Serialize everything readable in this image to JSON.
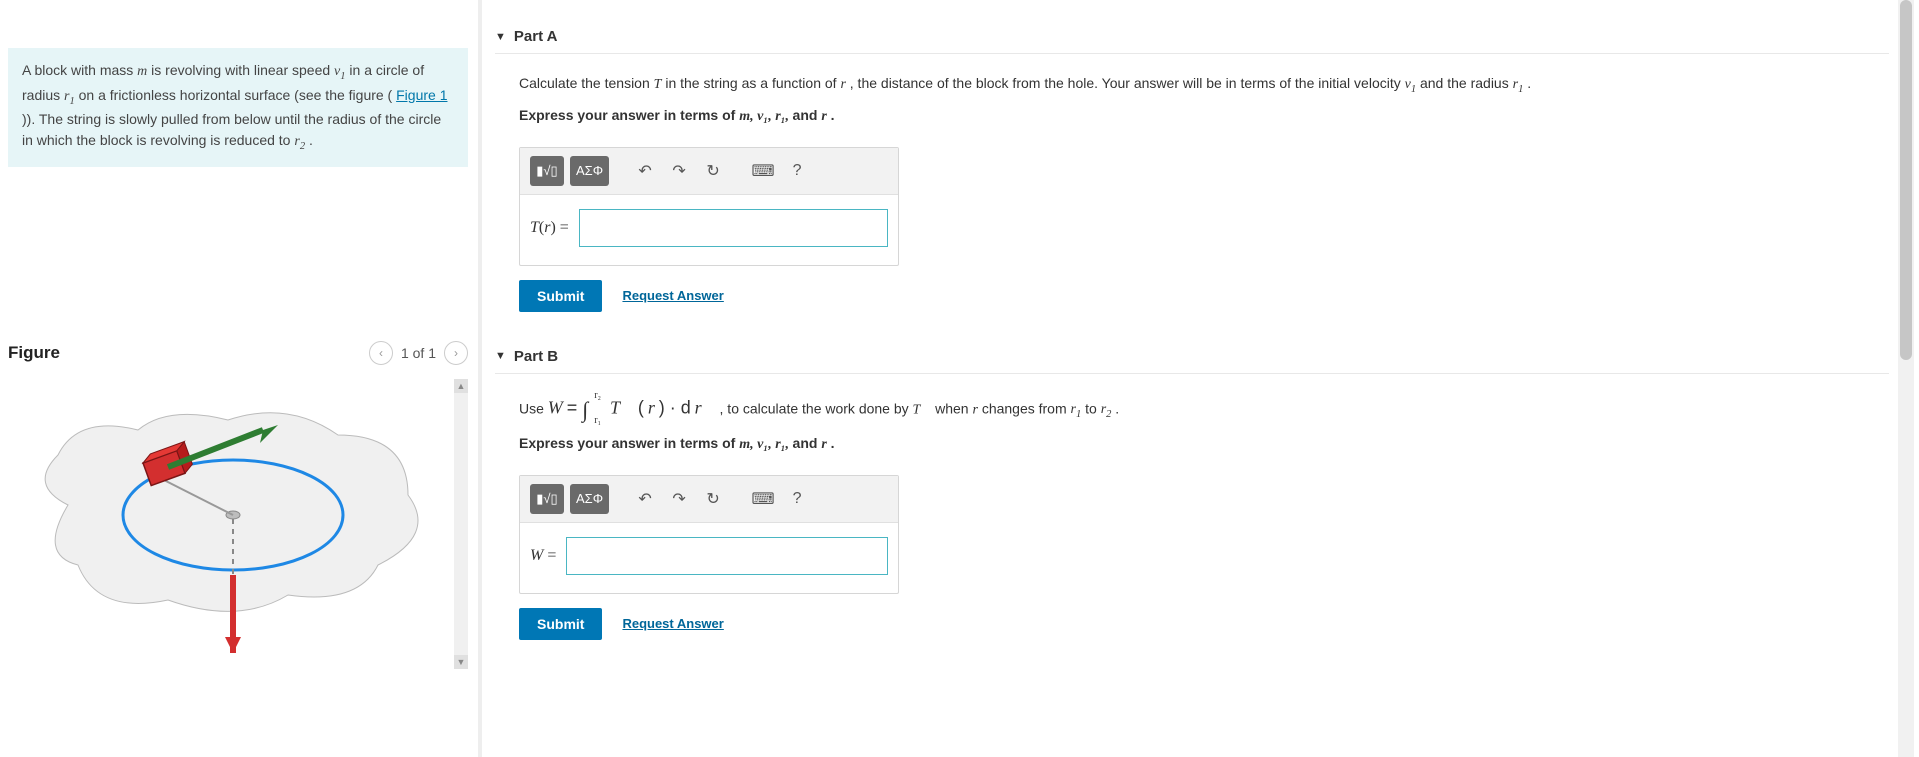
{
  "intro": {
    "text_pre": "A block with mass ",
    "m": "m",
    "text_2": " is revolving with linear speed ",
    "v1": "v",
    "v1_sub": "1",
    "text_3": " in a circle of radius ",
    "r1": "r",
    "r1_sub": "1",
    "text_4": " on a frictionless horizontal surface (see the figure (",
    "figure_link": "Figure 1",
    "text_5": ")). The string is slowly pulled from below until the radius of the circle in which the block is revolving is reduced to ",
    "r2": "r",
    "r2_sub": "2",
    "text_end": "."
  },
  "figure": {
    "title": "Figure",
    "pager": "1 of 1"
  },
  "partA": {
    "title": "Part A",
    "prompt_pre": "Calculate the tension ",
    "T": "T",
    "prompt_mid": " in the string as a function of ",
    "r": "r",
    "prompt_mid2": ", the distance of the block from the hole. Your answer will be in terms of the initial velocity ",
    "v1": "v",
    "v1_sub": "1",
    "prompt_mid3": " and the radius ",
    "r1": "r",
    "r1_sub": "1",
    "prompt_end": ".",
    "express_pre": "Express your answer in terms of ",
    "express_vars": "m, v₁, r₁, ",
    "express_and": "and ",
    "express_r": "r",
    "express_end": ".",
    "label_pre": "T",
    "label_paren": "(",
    "label_r": "r",
    "label_post": ") ="
  },
  "partB": {
    "title": "Part B",
    "prompt_pre": "Use ",
    "W": "W",
    "eq": " = ",
    "int_sym": "∫",
    "int_up": "r₂",
    "int_low": "r₁",
    "Tvec": "T⃗",
    "fn_open": " (",
    "fn_r": "r",
    "fn_close": ") · d",
    "rvec": "r⃗",
    "prompt_mid": ", to calculate the work done by ",
    "Tvec2": "T⃗",
    "prompt_mid2": " when ",
    "r": "r",
    "prompt_mid3": " changes from ",
    "r1": "r",
    "r1_sub": "1",
    "prompt_mid4": " to ",
    "r2": "r",
    "r2_sub": "2",
    "prompt_end": ".",
    "express_pre": "Express your answer in terms of ",
    "express_vars": "m, v₁, r₁, ",
    "express_and": "and ",
    "express_r": "r",
    "express_end": ".",
    "label": "W",
    "label_eq": " ="
  },
  "toolbar": {
    "templates": "▮√▯",
    "greek": "ΑΣΦ",
    "undo": "↶",
    "redo": "↷",
    "reset": "↻",
    "keyboard": "⌨",
    "help": "?"
  },
  "actions": {
    "submit": "Submit",
    "request": "Request Answer"
  }
}
